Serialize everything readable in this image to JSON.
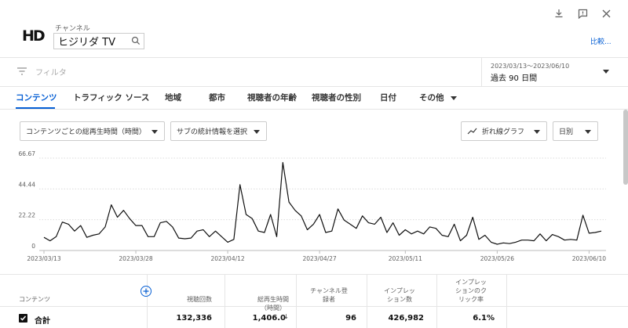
{
  "header": {
    "logo_text": "HD",
    "channel_label": "チャンネル",
    "channel_name": "ヒジリダ TV",
    "compare_link": "比較..."
  },
  "filter": {
    "placeholder": "フィルタ",
    "date_range": "2023/03/13～2023/06/10",
    "date_label": "過去 90 日間"
  },
  "tabs": [
    {
      "label": "コンテンツ",
      "active": true
    },
    {
      "label": "トラフィック ソース"
    },
    {
      "label": "地域"
    },
    {
      "label": "都市"
    },
    {
      "label": "視聴者の年齢"
    },
    {
      "label": "視聴者の性別"
    },
    {
      "label": "日付"
    },
    {
      "label": "その他"
    }
  ],
  "controls": {
    "metric_select": "コンテンツごとの総再生時間（時間）",
    "secondary_select": "サブの統計情報を選択",
    "chart_type": "折れ線グラフ",
    "granularity": "日別"
  },
  "chart_data": {
    "type": "line",
    "ylim": [
      0,
      66.67
    ],
    "yticks": [
      "66.67",
      "44.44",
      "22.22",
      "0"
    ],
    "xtick_labels": [
      "2023/03/13",
      "2023/03/28",
      "2023/04/12",
      "2023/04/27",
      "2023/05/11",
      "2023/05/26",
      "2023/06/10"
    ],
    "xtick_index": [
      0,
      15,
      30,
      45,
      59,
      74,
      89
    ],
    "color": "#111111",
    "series": [
      {
        "values": [
          9.5,
          7,
          10,
          20.5,
          19,
          14,
          18,
          9.5,
          11,
          12,
          17,
          33,
          24,
          29,
          23,
          18,
          18,
          10,
          10,
          20,
          21,
          17,
          9,
          8.5,
          9,
          14,
          15,
          10,
          14,
          10,
          6,
          8,
          47.5,
          26,
          23,
          14,
          13,
          26,
          10,
          63.5,
          35,
          29,
          25,
          15,
          19,
          26,
          13,
          14,
          30,
          22,
          19,
          16,
          25,
          20,
          19,
          24,
          13,
          20,
          11,
          15,
          12,
          14,
          12,
          17,
          16,
          11,
          10,
          19,
          7,
          11,
          24,
          8,
          11,
          6,
          4.5,
          5.5,
          5,
          6,
          7.5,
          7.5,
          7,
          12,
          7,
          11.5,
          10,
          7.5,
          8,
          7.5,
          25.5,
          12.5,
          13,
          14
        ]
      }
    ]
  },
  "table": {
    "headers": {
      "content": "コンテンツ",
      "views": "視聴回数",
      "watch_time": "総再生時間\n（時間）",
      "subscribers": "チャンネル登\n録者",
      "impressions": "インプレッ\nション数",
      "ctr": "インプレッ\nションのク\nリック率"
    },
    "sort_arrow": "↓",
    "total": {
      "label": "合計",
      "checked": true,
      "views": "132,336",
      "watch_time": "1,406.0",
      "subscribers": "96",
      "impressions": "426,982",
      "ctr": "6.1%"
    }
  }
}
